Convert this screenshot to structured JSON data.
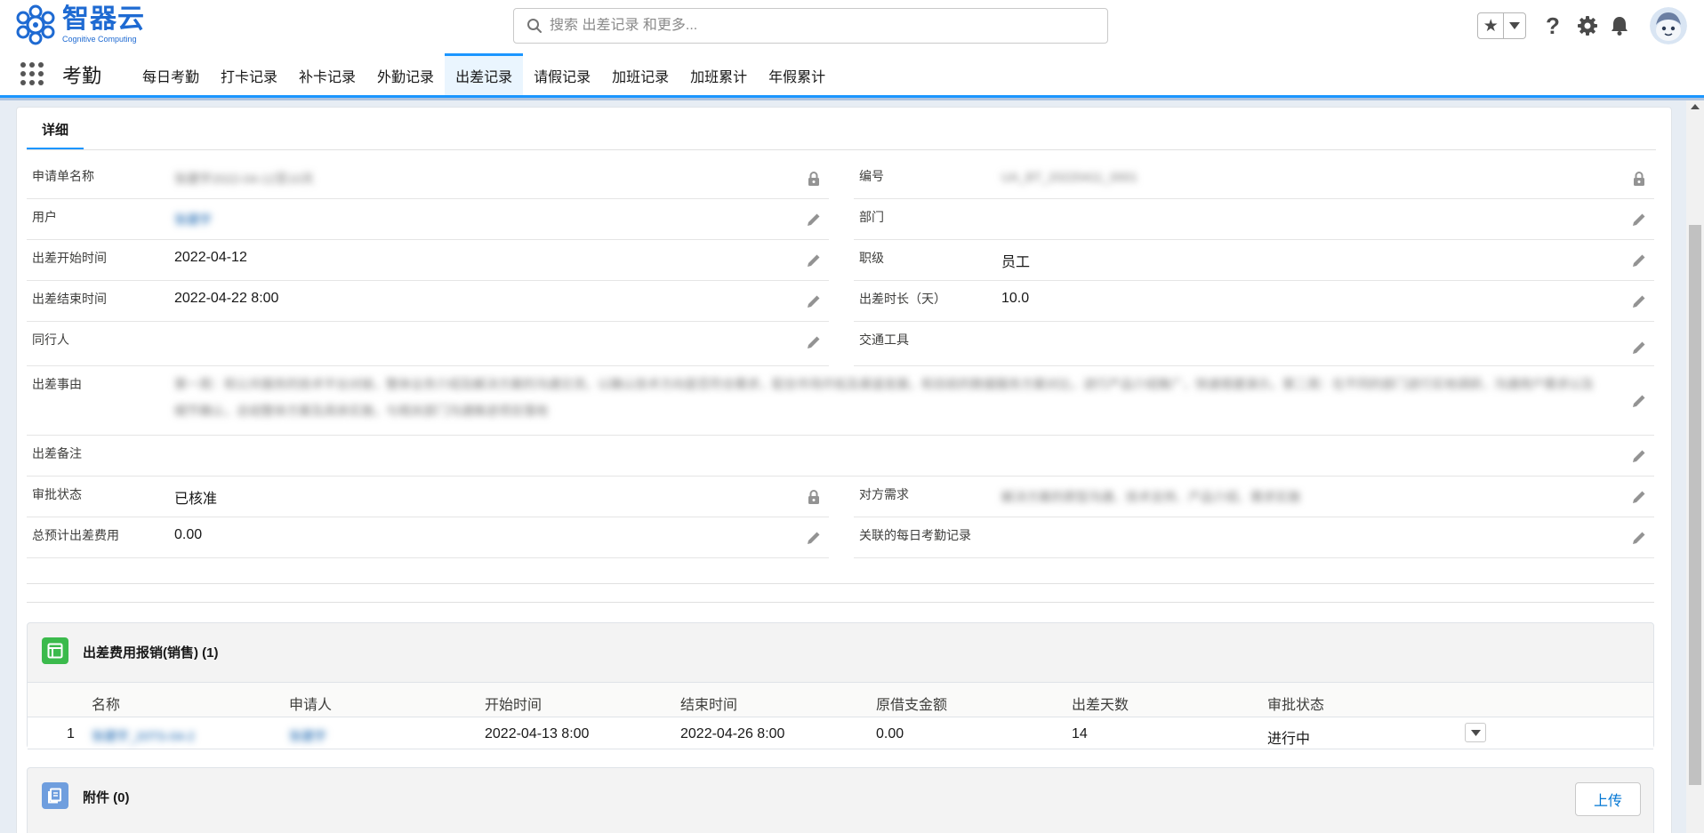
{
  "header": {
    "logo_cn": "智器云",
    "logo_en": "Cognitive Computing",
    "search_placeholder": "搜索 出差记录 和更多..."
  },
  "nav": {
    "app_name": "考勤",
    "tabs": [
      "每日考勤",
      "打卡记录",
      "补卡记录",
      "外勤记录",
      "出差记录",
      "请假记录",
      "加班记录",
      "加班累计",
      "年假累计"
    ],
    "active_tab": "出差记录"
  },
  "detail": {
    "tab_label": "详细",
    "fields": {
      "name": {
        "label": "申请单名称",
        "value": "张建宇2022-04-12至10天"
      },
      "number": {
        "label": "编号",
        "value": "UA_BT_20220411_0001"
      },
      "user": {
        "label": "用户",
        "value": "张建宇"
      },
      "dept": {
        "label": "部门",
        "value": ""
      },
      "start": {
        "label": "出差开始时间",
        "value": "2022-04-12"
      },
      "level": {
        "label": "职级",
        "value": "员工"
      },
      "end": {
        "label": "出差结束时间",
        "value": "2022-04-22 8:00"
      },
      "duration": {
        "label": "出差时长（天）",
        "value": "10.0"
      },
      "companion": {
        "label": "同行人",
        "value": ""
      },
      "transport": {
        "label": "交通工具",
        "value": ""
      },
      "reason": {
        "label": "出差事由",
        "value": "第一周：和公共服务的技术平台对接，整体业务介绍及解决方案的沟通交流，以确认技术方向是否符合需求，配合市场开拓及渠道发展，和目前的数据服务方案对比，进行产品介绍推广，快速搭建演示。第二周：在不同的部门进行实地调研，沟通用户需求以及细节确认，总结整体方案及具体实施，与相关部门沟通推进项目落地"
      },
      "remark": {
        "label": "出差备注",
        "value": ""
      },
      "approval": {
        "label": "审批状态",
        "value": "已核准"
      },
      "requirement": {
        "label": "对方需求",
        "value": "解决方案的原型沟通、技术支持、产品介绍、需求实施"
      },
      "budget": {
        "label": "总预计出差费用",
        "value": "0.00"
      },
      "related_daily": {
        "label": "关联的每日考勤记录",
        "value": ""
      }
    }
  },
  "expense": {
    "title": "出差费用报销(销售) (1)",
    "columns": [
      "名称",
      "申请人",
      "开始时间",
      "结束时间",
      "原借支金额",
      "出差天数",
      "审批状态"
    ],
    "rows": [
      {
        "num": "1",
        "name": "张建宇_20TS-04-2",
        "applicant": "张建宇",
        "start": "2022-04-13 8:00",
        "end": "2022-04-26 8:00",
        "amount": "0.00",
        "days": "14",
        "status": "进行中"
      }
    ]
  },
  "attachments": {
    "title": "附件 (0)",
    "upload_label": "上传"
  }
}
